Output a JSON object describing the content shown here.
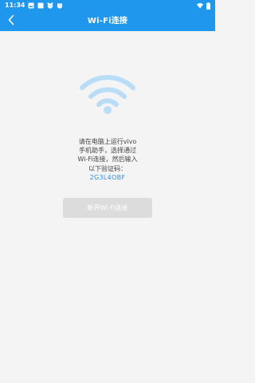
{
  "status_bar": {
    "time": "11:34",
    "left_icons": [
      "image-icon",
      "square-icon",
      "app-icon",
      "app-icon"
    ],
    "right_icons": [
      "wifi-signal-icon",
      "battery-icon"
    ]
  },
  "app_bar": {
    "title": "Wi-Fi连接",
    "back_icon": "chevron-left-icon",
    "background_color": "#1f97ec"
  },
  "main": {
    "wifi_icon": "wifi-icon",
    "wifi_icon_color": "#b9dcf7",
    "instructions": "请在电脑上运行vivo\n手机助手，选择通过\nWi-Fi连接，然后输入\n以下验证码：",
    "verification_code": "2G3L4OBF",
    "code_color": "#2b93e6",
    "disconnect_button_label": "断开Wi-Fi连接",
    "disconnect_button_enabled": false
  }
}
